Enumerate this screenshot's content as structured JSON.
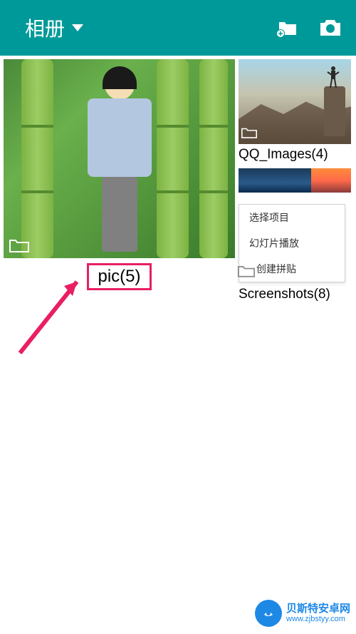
{
  "header": {
    "title": "相册",
    "icons": {
      "dropdown": "dropdown-arrow",
      "add_folder": "folder-add-icon",
      "camera": "camera-icon"
    }
  },
  "albums": {
    "main": {
      "label": "pic(5)",
      "folder_icon": "folder-icon"
    },
    "qq_images": {
      "label": "QQ_Images(4)",
      "folder_icon": "folder-icon"
    },
    "screenshots": {
      "label": "Screenshots(8)",
      "folder_icon": "folder-icon"
    }
  },
  "context_menu": {
    "items": [
      "选择项目",
      "幻灯片播放",
      "创建拼贴"
    ]
  },
  "watermark": {
    "name_cn": "贝斯特安卓网",
    "url": "www.zjbstyy.com"
  },
  "annotation": {
    "arrow_color": "#e91e63",
    "highlight_color": "#e91e63"
  }
}
